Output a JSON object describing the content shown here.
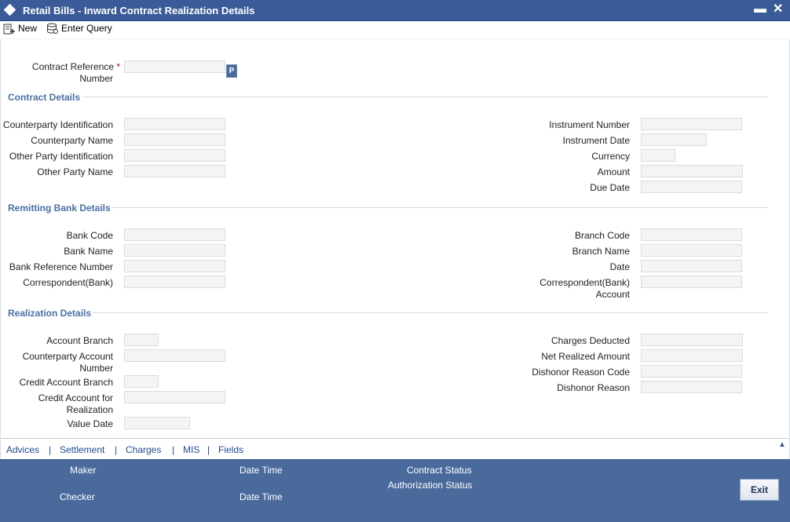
{
  "window": {
    "title": "Retail Bills - Inward Contract Realization Details",
    "minimize": "▬",
    "close": "✕"
  },
  "toolbar": {
    "new_label": "New",
    "enter_query_label": "Enter Query"
  },
  "contract_ref": {
    "label": "Contract Reference",
    "label2": "Number",
    "required": "*",
    "lov": "P"
  },
  "sections": {
    "contract": "Contract Details",
    "remitting": "Remitting Bank Details",
    "realization": "Realization Details"
  },
  "contract_details": {
    "counterparty_id": "Counterparty Identification",
    "counterparty_name": "Counterparty Name",
    "other_party_id": "Other Party Identification",
    "other_party_name": "Other Party Name",
    "instrument_number": "Instrument Number",
    "instrument_date": "Instrument Date",
    "currency": "Currency",
    "amount": "Amount",
    "due_date": "Due Date"
  },
  "remitting_bank": {
    "bank_code": "Bank Code",
    "bank_name": "Bank Name",
    "bank_ref": "Bank Reference Number",
    "correspondent": "Correspondent(Bank)",
    "branch_code": "Branch Code",
    "branch_name": "Branch Name",
    "date": "Date",
    "corr_account_1": "Correspondent(Bank)",
    "corr_account_2": "Account"
  },
  "realization": {
    "account_branch": "Account Branch",
    "cp_account_1": "Counterparty Account",
    "cp_account_2": "Number",
    "credit_branch": "Credit Account Branch",
    "credit_for_1": "Credit Account for",
    "credit_for_2": "Realization",
    "value_date": "Value Date",
    "charges_deducted": "Charges Deducted",
    "net_realized": "Net Realized Amount",
    "dishonor_code": "Dishonor Reason Code",
    "dishonor_reason": "Dishonor Reason"
  },
  "tabs": {
    "advices": "Advices",
    "settlement": "Settlement",
    "charges": "Charges",
    "mis": "MIS",
    "fields": "Fields",
    "separator": "|"
  },
  "footer": {
    "maker": "Maker",
    "checker": "Checker",
    "date_time_1": "Date Time",
    "date_time_2": "Date Time",
    "contract_status": "Contract Status",
    "auth_status": "Authorization Status",
    "exit": "Exit"
  }
}
